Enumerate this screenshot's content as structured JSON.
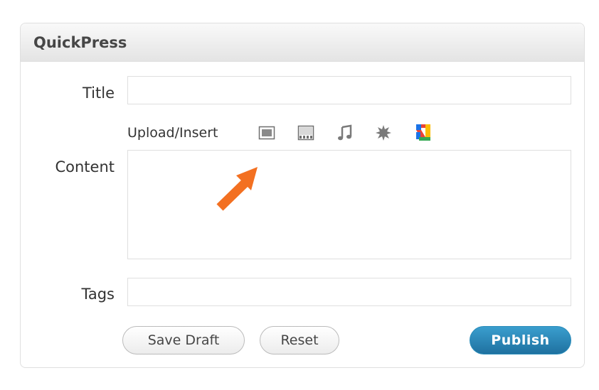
{
  "widget": {
    "title": "QuickPress"
  },
  "form": {
    "title_label": "Title",
    "title_value": "",
    "upload_insert_label": "Upload/Insert",
    "content_label": "Content",
    "content_value": "",
    "tags_label": "Tags",
    "tags_value": ""
  },
  "media_icons": [
    {
      "name": "add-image-icon"
    },
    {
      "name": "add-video-icon"
    },
    {
      "name": "add-audio-icon"
    },
    {
      "name": "add-media-icon"
    },
    {
      "name": "google-picker-icon"
    }
  ],
  "buttons": {
    "save_draft": "Save Draft",
    "reset": "Reset",
    "publish": "Publish"
  },
  "colors": {
    "publish_button": "#2173a1",
    "annotation_arrow": "#f37021"
  }
}
